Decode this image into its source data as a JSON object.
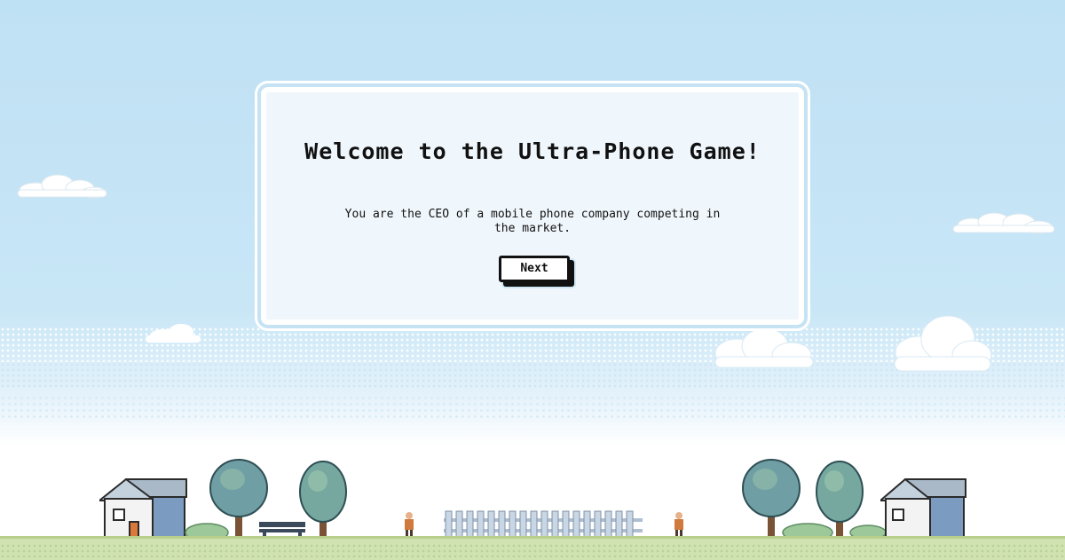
{
  "dialog": {
    "title": "Welcome to the Ultra-Phone Game!",
    "text": "You are the CEO of a mobile phone company competing in the market.",
    "next_label": "Next"
  },
  "colors": {
    "sky": "#bfe1f4",
    "dialog_bg": "#f0f7fc",
    "dialog_border": "#c5e3f3",
    "ground": "#cfe2b0",
    "tree": "#6f9fa4",
    "house_wall": "#f2f2f2",
    "house_side": "#7a9bbf",
    "roof": "#a8b8c8"
  },
  "scene": {
    "icons": [
      "cloud-icon",
      "house-icon",
      "tree-icon",
      "bench-icon",
      "fence-icon",
      "person-icon",
      "bush-icon"
    ]
  }
}
